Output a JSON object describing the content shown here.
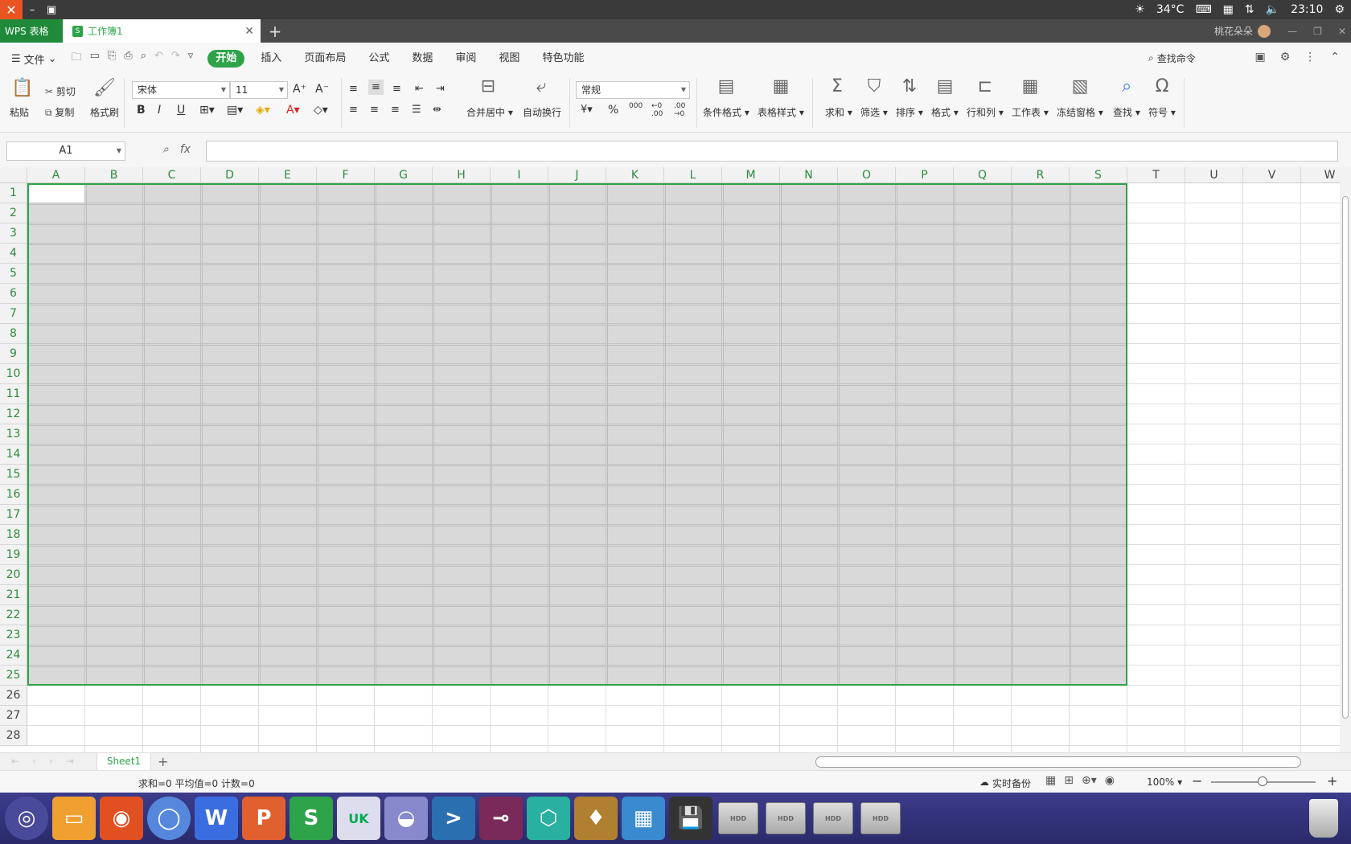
{
  "system": {
    "temperature": "34°C",
    "time": "23:10"
  },
  "tabbar": {
    "app_label": "WPS 表格",
    "doc_title": "工作簿1",
    "new_tab": "+",
    "user": "桃花朵朵"
  },
  "menu": {
    "file": "文件",
    "tabs": [
      "开始",
      "插入",
      "页面布局",
      "公式",
      "数据",
      "审阅",
      "视图",
      "特色功能"
    ],
    "search": "查找命令"
  },
  "ribbon": {
    "paste": "粘贴",
    "cut": "剪切",
    "copy": "复制",
    "format_painter": "格式刷",
    "font": "宋体",
    "size": "11",
    "merge_center": "合并居中",
    "wrap": "自动换行",
    "number_format": "常规",
    "cond_format": "条件格式",
    "table_style": "表格样式",
    "sum": "求和",
    "filter": "筛选",
    "sort": "排序",
    "format": "格式",
    "rowcol": "行和列",
    "worksheet": "工作表",
    "freeze": "冻结窗格",
    "find": "查找",
    "symbol": "符号"
  },
  "formula": {
    "name_box": "A1",
    "fx": "fx",
    "value": ""
  },
  "grid": {
    "columns": [
      "A",
      "B",
      "C",
      "D",
      "E",
      "F",
      "G",
      "H",
      "I",
      "J",
      "K",
      "L",
      "M",
      "N",
      "O",
      "P",
      "Q",
      "R",
      "S",
      "T",
      "U",
      "V",
      "W"
    ],
    "rows": [
      "1",
      "2",
      "3",
      "4",
      "5",
      "6",
      "7",
      "8",
      "9",
      "10",
      "11",
      "12",
      "13",
      "14",
      "15",
      "16",
      "17",
      "18",
      "19",
      "20",
      "21",
      "22",
      "23",
      "24",
      "25",
      "26",
      "27",
      "28"
    ],
    "selection": "A1:S25",
    "accent": "#2ea34a"
  },
  "sheets": {
    "active": "Sheet1",
    "add": "+"
  },
  "status": {
    "stats": "求和=0  平均值=0  计数=0",
    "backup": "实时备份",
    "zoom": "100%"
  }
}
